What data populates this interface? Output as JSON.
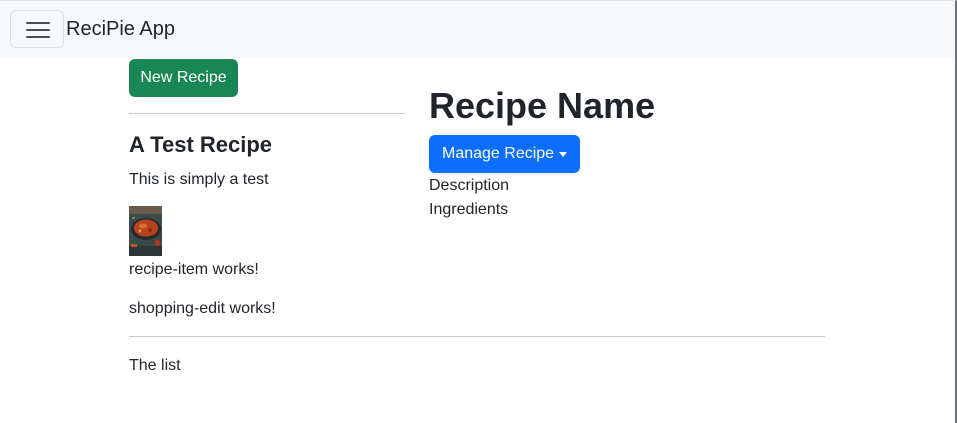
{
  "navbar": {
    "brand": "ReciPie App",
    "toggler_icon": "hamburger-menu-icon"
  },
  "recipe_list": {
    "new_button_label": "New Recipe",
    "items": [
      {
        "name": "A Test Recipe",
        "description": "This is simply a test",
        "image": "recipe-thumbnail-image"
      }
    ],
    "item_component_text": "recipe-item works!",
    "shopping_edit_text": "shopping-edit works!"
  },
  "recipe_detail": {
    "title": "Recipe Name",
    "manage_button_label": "Manage Recipe",
    "description_label": "Description",
    "ingredients_label": "Ingredients"
  },
  "shopping_list": {
    "title": "The list"
  },
  "colors": {
    "success": "#198754",
    "primary": "#0d6efd",
    "navbar_bg": "#f8f9fa",
    "text": "#212529"
  }
}
